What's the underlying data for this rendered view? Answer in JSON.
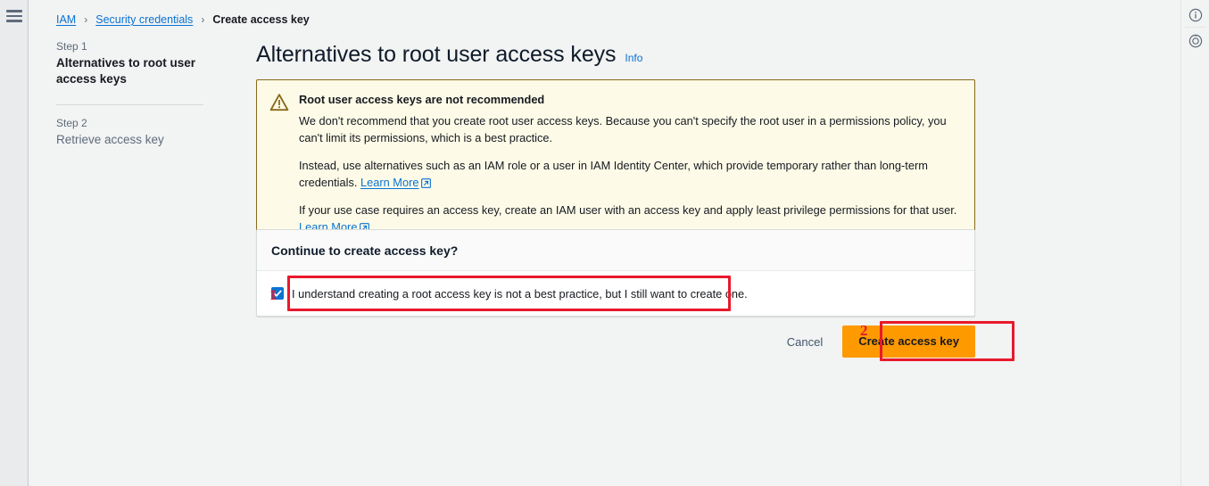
{
  "left_nav": {
    "menu_icon": "hamburger-menu-icon"
  },
  "right_rail": {
    "info_icon": "info-circle-icon",
    "history_icon": "clock-history-icon"
  },
  "breadcrumb": {
    "items": [
      {
        "label": "IAM",
        "link": true
      },
      {
        "label": "Security credentials",
        "link": true
      },
      {
        "label": "Create access key",
        "link": false
      }
    ],
    "separator": "›"
  },
  "stepnav": {
    "steps": [
      {
        "label": "Step 1",
        "title": "Alternatives to root user access keys",
        "active": true
      },
      {
        "label": "Step 2",
        "title": "Retrieve access key",
        "active": false
      }
    ]
  },
  "header": {
    "title": "Alternatives to root user access keys",
    "info_label": "Info"
  },
  "alert": {
    "icon": "warning-triangle-icon",
    "title": "Root user access keys are not recommended",
    "paragraph_1": "We don't recommend that you create root user access keys. Because you can't specify the root user in a permissions policy, you can't limit its permissions, which is a best practice.",
    "paragraph_2_text": "Instead, use alternatives such as an IAM role or a user in IAM Identity Center, which provide temporary rather than long-term credentials.",
    "paragraph_2_link": "Learn More",
    "paragraph_3_text": "If your use case requires an access key, create an IAM user with an access key and apply least privilege permissions for that user.",
    "paragraph_3_link": "Learn More",
    "background_color": "#fdfbe8",
    "border_color": "#8a6a1a",
    "icon_color": "#8a6a1a"
  },
  "card": {
    "header_title": "Continue to create access key?",
    "checkbox": {
      "checked": true,
      "label": "I understand creating a root access key is not a best practice, but I still want to create one.",
      "color": "#0972d3"
    }
  },
  "actions": {
    "cancel_label": "Cancel",
    "create_label": "Create access key",
    "create_color": "#ff9900"
  },
  "annotations": {
    "color": "#e8192c",
    "markers": [
      {
        "number": "1",
        "target": "acknowledgement-checkbox"
      },
      {
        "number": "2",
        "target": "create-access-key-button"
      }
    ]
  }
}
